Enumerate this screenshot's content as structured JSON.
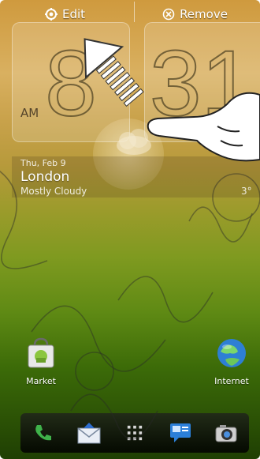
{
  "top_actions": {
    "edit_label": "Edit",
    "remove_label": "Remove"
  },
  "clock": {
    "hour": "8",
    "minute": "31",
    "ampm": "AM"
  },
  "weather": {
    "date": "Thu, Feb 9",
    "city": "London",
    "condition": "Mostly Cloudy",
    "temp": "3°"
  },
  "apps": {
    "market": "Market",
    "internet": "Internet"
  },
  "dock": {
    "items": [
      "phone-icon",
      "mail-icon",
      "apps-grid-icon",
      "messages-icon",
      "camera-icon"
    ]
  },
  "colors": {
    "accent": "#ffffff",
    "dock": "#111111"
  }
}
